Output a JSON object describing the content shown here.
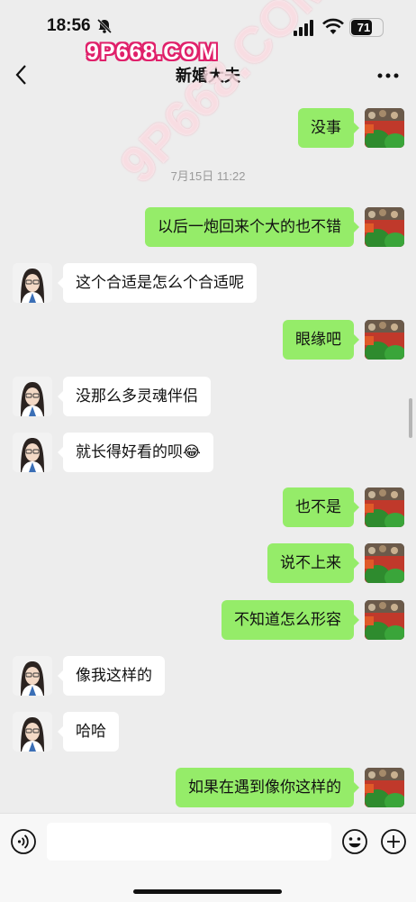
{
  "status_bar": {
    "time": "18:56",
    "battery": "71",
    "battery_level": 0.71
  },
  "watermark": {
    "top": "9P668.COM",
    "diagonal": "9P668.COM"
  },
  "nav": {
    "title": "新婚大夫"
  },
  "icons": {
    "back": "chevron-left-icon",
    "more": "ellipsis-icon",
    "voice": "voice-icon",
    "emoji": "emoji-icon",
    "plus": "plus-icon",
    "mute": "bell-slash-icon"
  },
  "colors": {
    "my_bubble": "#95ec69",
    "their_bubble": "#ffffff",
    "background": "#ededed",
    "watermark_pink": "#e0206a"
  },
  "messages": [
    {
      "from": "me",
      "text": "没事"
    },
    {
      "type": "timestamp",
      "text": "7月15日 11:22"
    },
    {
      "from": "me",
      "text": "以后一炮回来个大的也不错"
    },
    {
      "from": "them",
      "text": "这个合适是怎么个合适呢"
    },
    {
      "from": "me",
      "text": "眼缘吧"
    },
    {
      "from": "them",
      "text": "没那么多灵魂伴侣"
    },
    {
      "from": "them",
      "text": "就长得好看的呗😂"
    },
    {
      "from": "me",
      "text": "也不是"
    },
    {
      "from": "me",
      "text": "说不上来"
    },
    {
      "from": "me",
      "text": "不知道怎么形容"
    },
    {
      "from": "them",
      "text": "像我这样的"
    },
    {
      "from": "them",
      "text": "哈哈"
    },
    {
      "from": "me",
      "text": "如果在遇到像你这样的"
    }
  ]
}
